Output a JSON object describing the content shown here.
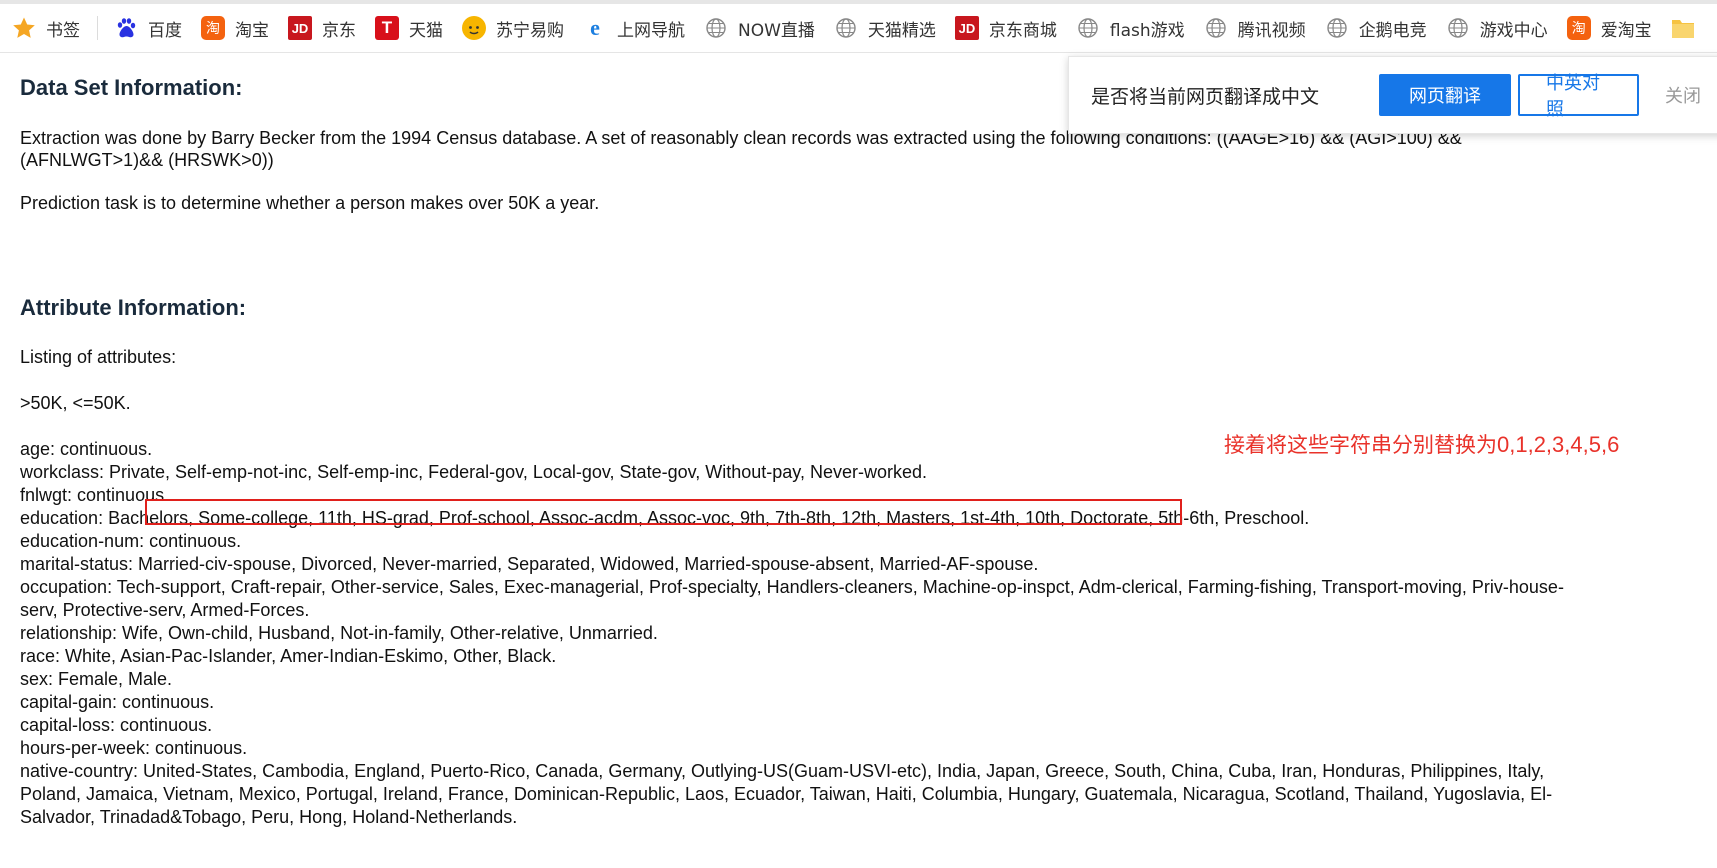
{
  "bookmarks_bar": {
    "items": [
      {
        "label": "书签",
        "icon": "star-icon"
      },
      {
        "label": "百度",
        "icon": "baidu-paw-icon"
      },
      {
        "label": "淘宝",
        "icon": "taobao-icon"
      },
      {
        "label": "京东",
        "icon": "jd-icon"
      },
      {
        "label": "天猫",
        "icon": "tmall-icon"
      },
      {
        "label": "苏宁易购",
        "icon": "suning-icon"
      },
      {
        "label": "上网导航",
        "icon": "ie-icon"
      },
      {
        "label": "NOW直播",
        "icon": "globe-icon"
      },
      {
        "label": "天猫精选",
        "icon": "globe-icon"
      },
      {
        "label": "京东商城",
        "icon": "jd-icon"
      },
      {
        "label": "flash游戏",
        "icon": "globe-icon"
      },
      {
        "label": "腾讯视频",
        "icon": "globe-icon"
      },
      {
        "label": "企鹅电竞",
        "icon": "globe-icon"
      },
      {
        "label": "游戏中心",
        "icon": "globe-icon"
      },
      {
        "label": "爱淘宝",
        "icon": "taobao-icon"
      },
      {
        "label": "",
        "icon": "folder-icon"
      }
    ],
    "jd_text": "JD",
    "tmall_text": "T",
    "taobao_text": "淘"
  },
  "translate_bar": {
    "prompt": "是否将当前网页翻译成中文",
    "translate_button": "网页翻译",
    "bilingual_button": "中英对照",
    "close": "关闭"
  },
  "content": {
    "dataset_heading": "Data Set Information:",
    "dataset_line1": "Extraction was done by Barry Becker from the 1994 Census database. A set of reasonably clean records was extracted using the following conditions: ((AAGE>16) && (AGI>100) &&",
    "dataset_line2": "(AFNLWGT>1)&& (HRSWK>0))",
    "prediction": "Prediction task is to determine whether a person makes over 50K a year.",
    "attribute_heading": "Attribute Information:",
    "listing": "Listing of attributes:",
    "classes": ">50K, <=50K.",
    "attributes": [
      "age: continuous.",
      "workclass: Private, Self-emp-not-inc, Self-emp-inc, Federal-gov, Local-gov, State-gov, Without-pay, Never-worked.",
      "fnlwgt: continuous.",
      "education: Bachelors, Some-college, 11th, HS-grad, Prof-school, Assoc-acdm, Assoc-voc, 9th, 7th-8th, 12th, Masters, 1st-4th, 10th, Doctorate, 5th-6th, Preschool.",
      "education-num: continuous.",
      "marital-status: Married-civ-spouse, Divorced, Never-married, Separated, Widowed, Married-spouse-absent, Married-AF-spouse.",
      "occupation: Tech-support, Craft-repair, Other-service, Sales, Exec-managerial, Prof-specialty, Handlers-cleaners, Machine-op-inspct, Adm-clerical, Farming-fishing, Transport-moving, Priv-house-",
      "serv, Protective-serv, Armed-Forces.",
      "relationship: Wife, Own-child, Husband, Not-in-family, Other-relative, Unmarried.",
      "race: White, Asian-Pac-Islander, Amer-Indian-Eskimo, Other, Black.",
      "sex: Female, Male.",
      "capital-gain: continuous.",
      "capital-loss: continuous.",
      "hours-per-week: continuous.",
      "native-country: United-States, Cambodia, England, Puerto-Rico, Canada, Germany, Outlying-US(Guam-USVI-etc), India, Japan, Greece, South, China, Cuba, Iran, Honduras, Philippines, Italy,",
      "Poland, Jamaica, Vietnam, Mexico, Portugal, Ireland, France, Dominican-Republic, Laos, Ecuador, Taiwan, Haiti, Columbia, Hungary, Guatemala, Nicaragua, Scotland, Thailand, Yugoslavia, El-",
      "Salvador, Trinadad&Tobago, Peru, Hong, Holand-Netherlands."
    ]
  },
  "annotation": {
    "text": "接着将这些字符串分别替换为",
    "digits": "0,1,2,3,4,5,6",
    "color": "#e9322a"
  },
  "highlight_box_color": "#e0201c"
}
